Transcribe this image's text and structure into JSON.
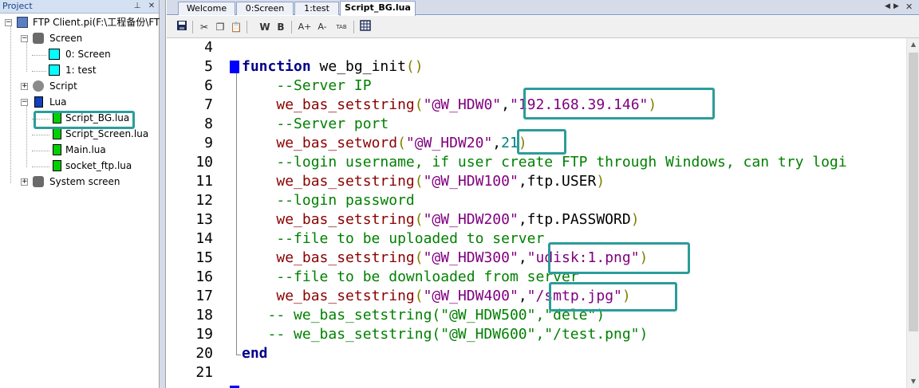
{
  "project": {
    "title": "Project",
    "pin_icon": "pin-icon",
    "close_icon": "close-icon",
    "tree": {
      "root": "FTP Client.pi(F:\\工程备份\\FT",
      "screen": "Screen",
      "screen_items": [
        "0: Screen",
        "1: test"
      ],
      "script": "Script",
      "lua": "Lua",
      "lua_items": [
        "Script_BG.lua",
        "Script_Screen.lua",
        "Main.lua",
        "socket_ftp.lua"
      ],
      "system_screen": "System screen"
    }
  },
  "tabs": [
    "Welcome",
    "0:Screen",
    "1:test",
    "Script_BG.lua"
  ],
  "active_tab": "Script_BG.lua",
  "toolbar": {
    "icons": [
      "save-icon",
      "cut-icon",
      "copy-icon",
      "paste-icon",
      "word-wrap-icon",
      "bold-icon",
      "font-increase-icon",
      "font-decrease-icon",
      "tab-icon",
      "grid-icon"
    ],
    "w_label": "W",
    "b_label": "B",
    "a_plus": "A+",
    "a_minus": "A-",
    "tab_label": "TAB"
  },
  "editor": {
    "lines": [
      {
        "n": "4",
        "parts": []
      },
      {
        "n": "5",
        "parts": [
          [
            "kw",
            "function"
          ],
          [
            "pn",
            " "
          ],
          [
            "fn",
            "we_bg_init"
          ],
          [
            "brk",
            "()"
          ]
        ]
      },
      {
        "n": "6",
        "parts": [
          [
            "cm",
            "    --Server IP"
          ]
        ]
      },
      {
        "n": "7",
        "parts": [
          [
            "pn",
            "    "
          ],
          [
            "bi",
            "we_bas_setstring"
          ],
          [
            "brk",
            "("
          ],
          [
            "st",
            "\"@W_HDW0\""
          ],
          [
            "pn",
            ","
          ],
          [
            "st",
            "\"192.168.39.146\""
          ],
          [
            "brk",
            ")"
          ]
        ]
      },
      {
        "n": "8",
        "parts": [
          [
            "cm",
            "    --Server port"
          ]
        ]
      },
      {
        "n": "9",
        "parts": [
          [
            "pn",
            "    "
          ],
          [
            "bi",
            "we_bas_setword"
          ],
          [
            "brk",
            "("
          ],
          [
            "st",
            "\"@W_HDW20\""
          ],
          [
            "pn",
            ","
          ],
          [
            "nm",
            "21"
          ],
          [
            "brk",
            ")"
          ]
        ]
      },
      {
        "n": "10",
        "parts": [
          [
            "cm",
            "    --login username, if user create FTP through Windows, can try logi"
          ]
        ]
      },
      {
        "n": "11",
        "parts": [
          [
            "pn",
            "    "
          ],
          [
            "bi",
            "we_bas_setstring"
          ],
          [
            "brk",
            "("
          ],
          [
            "st",
            "\"@W_HDW100\""
          ],
          [
            "pn",
            ",ftp.USER"
          ],
          [
            "brk",
            ")"
          ]
        ]
      },
      {
        "n": "12",
        "parts": [
          [
            "cm",
            "    --login password"
          ]
        ]
      },
      {
        "n": "13",
        "parts": [
          [
            "pn",
            "    "
          ],
          [
            "bi",
            "we_bas_setstring"
          ],
          [
            "brk",
            "("
          ],
          [
            "st",
            "\"@W_HDW200\""
          ],
          [
            "pn",
            ",ftp.PASSWORD"
          ],
          [
            "brk",
            ")"
          ]
        ]
      },
      {
        "n": "14",
        "parts": [
          [
            "cm",
            "    --file to be uploaded to server"
          ]
        ]
      },
      {
        "n": "15",
        "parts": [
          [
            "pn",
            "    "
          ],
          [
            "bi",
            "we_bas_setstring"
          ],
          [
            "brk",
            "("
          ],
          [
            "st",
            "\"@W_HDW300\""
          ],
          [
            "pn",
            ","
          ],
          [
            "st",
            "\"udisk:1.png\""
          ],
          [
            "brk",
            ")"
          ]
        ]
      },
      {
        "n": "16",
        "parts": [
          [
            "cm",
            "    --file to be downloaded from server"
          ]
        ]
      },
      {
        "n": "17",
        "parts": [
          [
            "pn",
            "    "
          ],
          [
            "bi",
            "we_bas_setstring"
          ],
          [
            "brk",
            "("
          ],
          [
            "st",
            "\"@W_HDW400\""
          ],
          [
            "pn",
            ","
          ],
          [
            "st",
            "\"/smtp.jpg\""
          ],
          [
            "brk",
            ")"
          ]
        ]
      },
      {
        "n": "18",
        "parts": [
          [
            "cm",
            "   -- we_bas_setstring(\"@W_HDW500\",\"dele\")"
          ]
        ]
      },
      {
        "n": "19",
        "parts": [
          [
            "cm",
            "   -- we_bas_setstring(\"@W_HDW600\",\"/test.png\")"
          ]
        ]
      },
      {
        "n": "20",
        "parts": [
          [
            "kw",
            "end"
          ]
        ]
      },
      {
        "n": "21",
        "parts": []
      }
    ]
  },
  "colors": {
    "highlight": "#2b9d9a",
    "keyword": "#00008b",
    "comment": "#008000",
    "builtin": "#8b0000",
    "string": "#800080",
    "number": "#008080"
  }
}
